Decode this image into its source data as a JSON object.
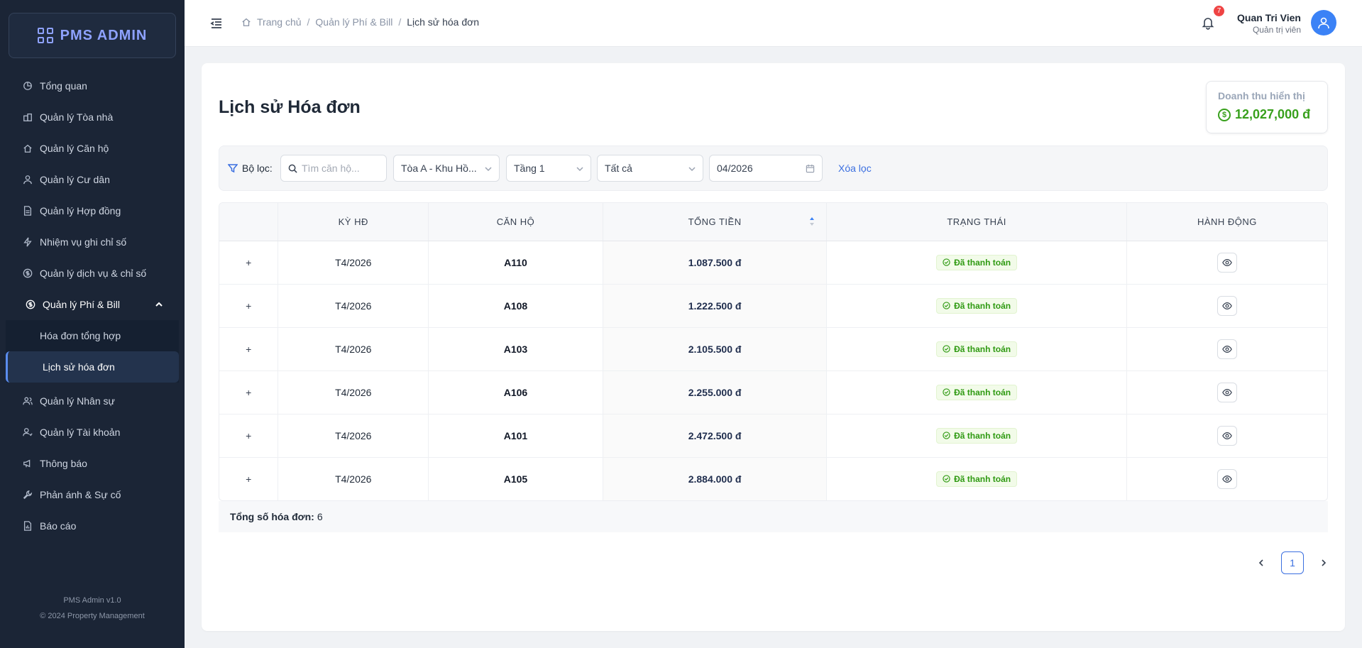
{
  "app": {
    "logo_text": "PMS ADMIN"
  },
  "sidebar": {
    "items": [
      {
        "label": "Tổng quan",
        "icon": "pie-chart-icon"
      },
      {
        "label": "Quản lý Tòa nhà",
        "icon": "building-icon"
      },
      {
        "label": "Quản lý Căn hộ",
        "icon": "home-icon"
      },
      {
        "label": "Quản lý Cư dân",
        "icon": "user-icon"
      },
      {
        "label": "Quản lý Hợp đồng",
        "icon": "file-icon"
      },
      {
        "label": "Nhiệm vụ ghi chỉ số",
        "icon": "bolt-icon"
      },
      {
        "label": "Quản lý dịch vụ & chỉ số",
        "icon": "dollar-circle-icon"
      }
    ],
    "active_group": {
      "label": "Quản lý Phí & Bill",
      "icon": "dollar-circle-icon",
      "children": [
        {
          "label": "Hóa đơn tổng hợp"
        },
        {
          "label": "Lịch sử hóa đơn",
          "active": true
        }
      ]
    },
    "items_after": [
      {
        "label": "Quản lý Nhân sự",
        "icon": "team-icon"
      },
      {
        "label": "Quản lý Tài khoản",
        "icon": "account-icon"
      },
      {
        "label": "Thông báo",
        "icon": "megaphone-icon"
      },
      {
        "label": "Phản ánh & Sự cố",
        "icon": "tool-icon"
      },
      {
        "label": "Báo cáo",
        "icon": "report-icon"
      }
    ],
    "footer": {
      "version": "PMS Admin v1.0",
      "copyright": "© 2024 Property Management"
    }
  },
  "header": {
    "breadcrumb": [
      "Trang chủ",
      "Quản lý Phí & Bill",
      "Lịch sử hóa đơn"
    ],
    "notification_count": "7",
    "user_name": "Quan Tri Vien",
    "user_role": "Quản trị viên"
  },
  "page": {
    "title": "Lịch sử Hóa đơn",
    "revenue_label": "Doanh thu hiển thị",
    "revenue_value": "12,027,000 đ"
  },
  "filters": {
    "label": "Bộ lọc:",
    "search_placeholder": "Tìm căn hộ...",
    "building": "Tòa A - Khu Hồ...",
    "floor": "Tầng 1",
    "status": "Tất cả",
    "period": "04/2026",
    "clear_label": "Xóa lọc"
  },
  "table": {
    "columns": [
      "",
      "KỲ HĐ",
      "CĂN HỘ",
      "TỔNG TIỀN",
      "TRẠNG THÁI",
      "HÀNH ĐỘNG"
    ],
    "rows": [
      {
        "period": "T4/2026",
        "unit": "A110",
        "total": "1.087.500 đ",
        "status": "Đã thanh toán"
      },
      {
        "period": "T4/2026",
        "unit": "A108",
        "total": "1.222.500 đ",
        "status": "Đã thanh toán"
      },
      {
        "period": "T4/2026",
        "unit": "A103",
        "total": "2.105.500 đ",
        "status": "Đã thanh toán"
      },
      {
        "period": "T4/2026",
        "unit": "A106",
        "total": "2.255.000 đ",
        "status": "Đã thanh toán"
      },
      {
        "period": "T4/2026",
        "unit": "A101",
        "total": "2.472.500 đ",
        "status": "Đã thanh toán"
      },
      {
        "period": "T4/2026",
        "unit": "A105",
        "total": "2.884.000 đ",
        "status": "Đã thanh toán"
      }
    ]
  },
  "summary": {
    "label": "Tổng số hóa đơn:",
    "count": "6"
  },
  "pagination": {
    "current": "1"
  },
  "colors": {
    "sidebar_bg": "#1b2536",
    "accent": "#3b6fe0",
    "success": "#38a01c",
    "logo": "#8ea2ff"
  }
}
